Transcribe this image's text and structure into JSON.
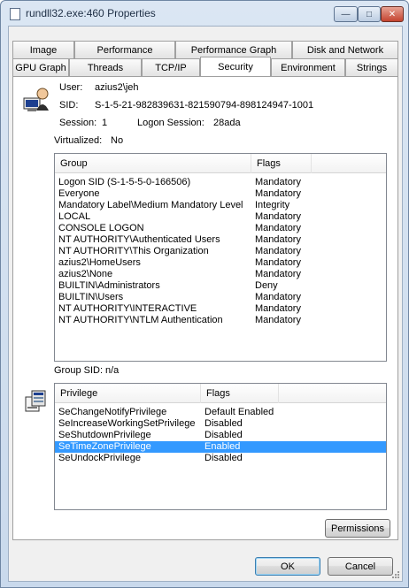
{
  "window": {
    "title": "rundll32.exe:460 Properties"
  },
  "titlebar_buttons": {
    "minimize": "—",
    "maximize": "□",
    "close": "✕"
  },
  "tabs": {
    "row1": [
      "Image",
      "Performance",
      "Performance Graph",
      "Disk and Network"
    ],
    "row2": [
      "GPU Graph",
      "Threads",
      "TCP/IP",
      "Security",
      "Environment",
      "Strings"
    ],
    "active": "Security"
  },
  "security": {
    "user_label": "User:",
    "user_value": "azius2\\jeh",
    "sid_label": "SID:",
    "sid_value": "S-1-5-21-982839631-821590794-898124947-1001",
    "session_label": "Session:",
    "session_value": "1",
    "logon_session_label": "Logon Session:",
    "logon_session_value": "28ada",
    "virtualized_label": "Virtualized:",
    "virtualized_value": "No",
    "group_sid_label": "Group SID:",
    "group_sid_value": "n/a"
  },
  "groups": {
    "columns": [
      "Group",
      "Flags"
    ],
    "rows": [
      [
        "Logon SID (S-1-5-5-0-166506)",
        "Mandatory"
      ],
      [
        "Everyone",
        "Mandatory"
      ],
      [
        "Mandatory Label\\Medium Mandatory Level",
        "Integrity"
      ],
      [
        "LOCAL",
        "Mandatory"
      ],
      [
        "CONSOLE LOGON",
        "Mandatory"
      ],
      [
        "NT AUTHORITY\\Authenticated Users",
        "Mandatory"
      ],
      [
        "NT AUTHORITY\\This Organization",
        "Mandatory"
      ],
      [
        "azius2\\HomeUsers",
        "Mandatory"
      ],
      [
        "azius2\\None",
        "Mandatory"
      ],
      [
        "BUILTIN\\Administrators",
        "Deny"
      ],
      [
        "BUILTIN\\Users",
        "Mandatory"
      ],
      [
        "NT AUTHORITY\\INTERACTIVE",
        "Mandatory"
      ],
      [
        "NT AUTHORITY\\NTLM Authentication",
        "Mandatory"
      ]
    ]
  },
  "privileges": {
    "columns": [
      "Privilege",
      "Flags"
    ],
    "rows": [
      [
        "SeChangeNotifyPrivilege",
        "Default Enabled"
      ],
      [
        "SeIncreaseWorkingSetPrivilege",
        "Disabled"
      ],
      [
        "SeShutdownPrivilege",
        "Disabled"
      ],
      [
        "SeTimeZonePrivilege",
        "Enabled"
      ],
      [
        "SeUndockPrivilege",
        "Disabled"
      ]
    ],
    "selected_index": 3
  },
  "buttons": {
    "permissions": "Permissions",
    "ok": "OK",
    "cancel": "Cancel"
  },
  "colors": {
    "selection": "#3399ff",
    "window_frame": "#c9d9ec",
    "close_button": "#c4432f"
  }
}
